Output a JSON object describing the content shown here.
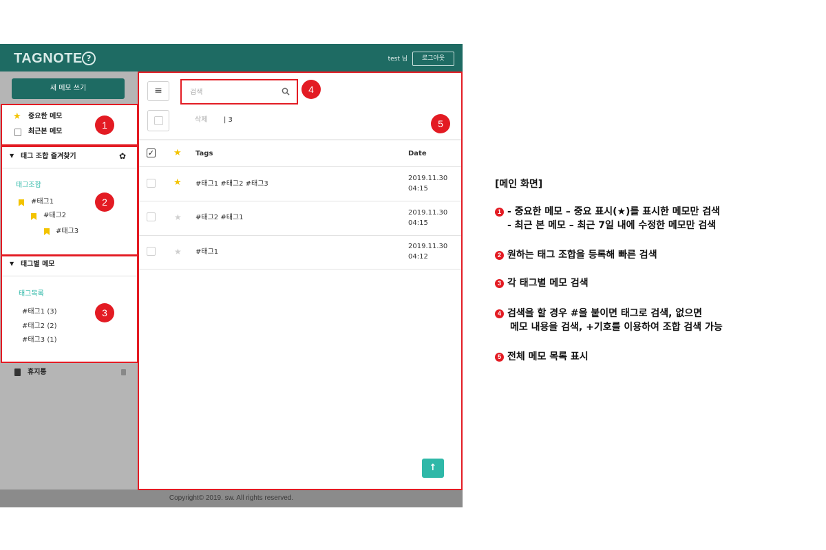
{
  "header": {
    "logo": "TAGNOTE",
    "help_icon": "?",
    "user_label": "test 님",
    "logout_label": "로그아웃",
    "bg_color": "#1e6b63"
  },
  "sidebar": {
    "new_memo_label": "새 메모 쓰기",
    "quick_items": [
      {
        "label": "중요한 메모",
        "icon": "star-icon"
      },
      {
        "label": "최근본 메모",
        "icon": "note-icon"
      }
    ],
    "favorites": {
      "title": "태그 조합 즐겨찾기",
      "settings_icon": "✿",
      "group_label": "태그조합",
      "tags": [
        "#태그1",
        "#태그2",
        "#태그3"
      ]
    },
    "tag_memos": {
      "title": "태그별 메모",
      "list_label": "태그목록",
      "tags": [
        {
          "label": "#태그1",
          "count": "(3)"
        },
        {
          "label": "#태그2",
          "count": "(2)"
        },
        {
          "label": "#태그3",
          "count": "(1)"
        }
      ]
    },
    "trash_label": "휴지통"
  },
  "main": {
    "menu_icon": "≡",
    "search_placeholder": "검색",
    "delete_label": "삭제",
    "count_label": "| 3",
    "columns": {
      "tags": "Tags",
      "date": "Date"
    },
    "rows": [
      {
        "tags": "#태그1 #태그2 #태그3",
        "date": "2019.11.30",
        "time": "04:15",
        "starred": true
      },
      {
        "tags": "#태그2 #태그1",
        "date": "2019.11.30",
        "time": "04:15",
        "starred": false
      },
      {
        "tags": "#태그1",
        "date": "2019.11.30",
        "time": "04:12",
        "starred": false
      }
    ],
    "top_icon": "↑"
  },
  "badges": [
    "1",
    "2",
    "3",
    "4",
    "5"
  ],
  "footer": "Copyright© 2019. sw. All rights reserved.",
  "description": {
    "title": "[메인 화면]",
    "items": [
      {
        "num": "1",
        "lines": [
          "- 중요한 메모 – 중요 표시(★)를 표시한 메모만 검색",
          "- 최근 본 메모 – 최근 7일 내에 수정한 메모만 검색"
        ]
      },
      {
        "num": "2",
        "lines": [
          "원하는 태그 조합을 등록해 빠른 검색"
        ]
      },
      {
        "num": "3",
        "lines": [
          "각 태그별 메모 검색"
        ]
      },
      {
        "num": "4",
        "lines": [
          "검색을 할 경우 #을 붙이면 태그로 검색, 없으면",
          "메모 내용을 검색, +기호를 이용하여 조합 검색 가능"
        ]
      },
      {
        "num": "5",
        "lines": [
          "전체 메모 목록 표시"
        ]
      }
    ]
  },
  "colors": {
    "accent": "#1e6b63",
    "teal": "#2fb8a8",
    "highlight": "#e31b23",
    "star": "#f3c300"
  }
}
